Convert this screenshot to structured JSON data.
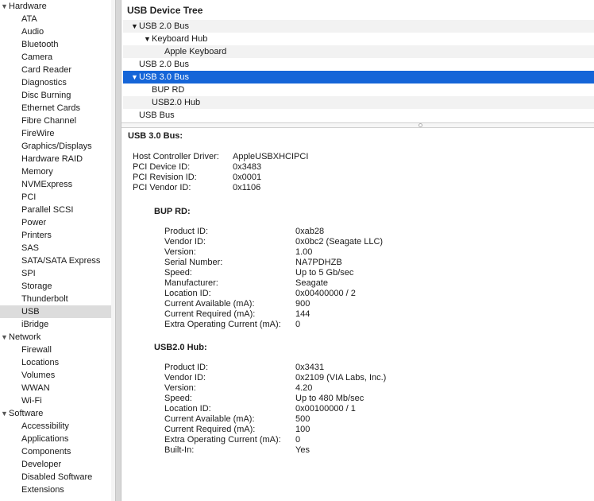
{
  "sidebar": {
    "groups": [
      {
        "label": "Hardware",
        "items": [
          "ATA",
          "Audio",
          "Bluetooth",
          "Camera",
          "Card Reader",
          "Diagnostics",
          "Disc Burning",
          "Ethernet Cards",
          "Fibre Channel",
          "FireWire",
          "Graphics/Displays",
          "Hardware RAID",
          "Memory",
          "NVMExpress",
          "PCI",
          "Parallel SCSI",
          "Power",
          "Printers",
          "SAS",
          "SATA/SATA Express",
          "SPI",
          "Storage",
          "Thunderbolt",
          "USB",
          "iBridge"
        ]
      },
      {
        "label": "Network",
        "items": [
          "Firewall",
          "Locations",
          "Volumes",
          "WWAN",
          "Wi-Fi"
        ]
      },
      {
        "label": "Software",
        "items": [
          "Accessibility",
          "Applications",
          "Components",
          "Developer",
          "Disabled Software",
          "Extensions"
        ]
      }
    ],
    "selected": "USB"
  },
  "tree": {
    "header": "USB Device Tree",
    "rows": [
      {
        "label": "USB 2.0 Bus",
        "expanded": true
      },
      {
        "label": "Keyboard Hub",
        "expanded": true
      },
      {
        "label": "Apple Keyboard"
      },
      {
        "label": "USB 2.0 Bus"
      },
      {
        "label": "USB 3.0 Bus",
        "expanded": true,
        "selected": true
      },
      {
        "label": "BUP RD"
      },
      {
        "label": "USB2.0 Hub"
      },
      {
        "label": "USB Bus"
      }
    ]
  },
  "detail": {
    "title": "USB 3.0 Bus:",
    "bus_props": [
      {
        "k": "Host Controller Driver:",
        "v": "AppleUSBXHCIPCI"
      },
      {
        "k": "PCI Device ID:",
        "v": "0x3483"
      },
      {
        "k": "PCI Revision ID:",
        "v": "0x0001"
      },
      {
        "k": "PCI Vendor ID:",
        "v": "0x1106"
      }
    ],
    "devices": [
      {
        "title": "BUP RD:",
        "props": [
          {
            "k": "Product ID:",
            "v": "0xab28"
          },
          {
            "k": "Vendor ID:",
            "v": "0x0bc2  (Seagate LLC)"
          },
          {
            "k": "Version:",
            "v": "1.00"
          },
          {
            "k": "Serial Number:",
            "v": "NA7PDHZB"
          },
          {
            "k": "Speed:",
            "v": "Up to 5 Gb/sec"
          },
          {
            "k": "Manufacturer:",
            "v": "Seagate"
          },
          {
            "k": "Location ID:",
            "v": "0x00400000 / 2"
          },
          {
            "k": "Current Available (mA):",
            "v": "900"
          },
          {
            "k": "Current Required (mA):",
            "v": "144"
          },
          {
            "k": "Extra Operating Current (mA):",
            "v": "0"
          }
        ]
      },
      {
        "title": "USB2.0 Hub:",
        "props": [
          {
            "k": "Product ID:",
            "v": "0x3431"
          },
          {
            "k": "Vendor ID:",
            "v": "0x2109  (VIA Labs, Inc.)"
          },
          {
            "k": "Version:",
            "v": "4.20"
          },
          {
            "k": "Speed:",
            "v": "Up to 480 Mb/sec"
          },
          {
            "k": "Location ID:",
            "v": "0x00100000 / 1"
          },
          {
            "k": "Current Available (mA):",
            "v": "500"
          },
          {
            "k": "Current Required (mA):",
            "v": "100"
          },
          {
            "k": "Extra Operating Current (mA):",
            "v": "0"
          },
          {
            "k": "Built-In:",
            "v": "Yes"
          }
        ]
      }
    ]
  },
  "colors": {
    "selection": "#1565d8",
    "sidebar_selected": "#dcdcdc"
  },
  "icons": {
    "expanded": "disclosure-triangle-down-icon"
  }
}
